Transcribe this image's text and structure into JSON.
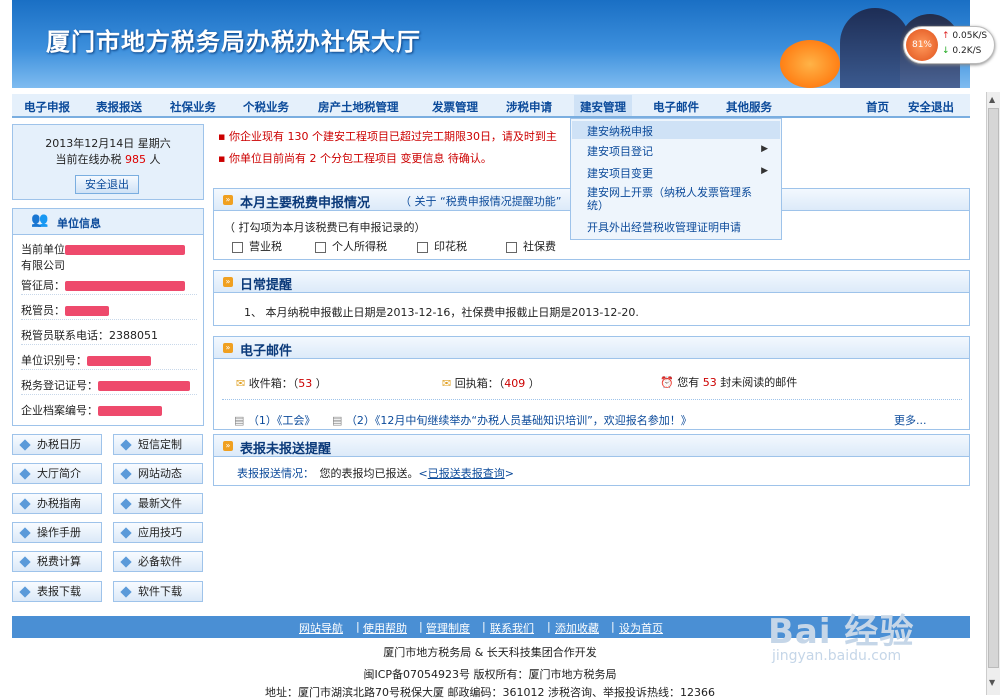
{
  "banner": {
    "title": "厦门市地方税务局办税办社保大厅"
  },
  "speed": {
    "percent": "81%",
    "up": "0.05K/S",
    "down": "0.2K/S"
  },
  "nav": {
    "items": [
      "电子申报",
      "表报报送",
      "社保业务",
      "个税业务",
      "房产土地税管理",
      "发票管理",
      "涉税申请",
      "建安管理",
      "电子邮件",
      "其他服务"
    ],
    "home": "首页",
    "logout": "安全退出"
  },
  "dropdown": [
    "建安纳税申报",
    "建安项目登记",
    "建安项目变更",
    "建安网上开票（纳税人发票管理系统）",
    "开具外出经营税收管理证明申请"
  ],
  "datebox": {
    "date": "2013年12月14日  星期六",
    "online_pre": "当前在线办税",
    "online_num": "985",
    "online_post": "人",
    "logout": "安全退出"
  },
  "unit": {
    "title": "单位信息",
    "fields": [
      "当前单位",
      "有限公司",
      "管征局：",
      "税管员：",
      "税管员联系电话：2388051",
      "单位识别号：",
      "税务登记证号：",
      "企业档案编号："
    ]
  },
  "side_buttons": [
    "办税日历",
    "短信定制",
    "大厅简介",
    "网站动态",
    "办税指南",
    "最新文件",
    "操作手册",
    "应用技巧",
    "税费计算",
    "必备软件",
    "表报下载",
    "软件下载"
  ],
  "notices": [
    "你企业现有 130 个建安工程项目已超过完工期限30日，请及时到主",
    "你单位目前尚有 2 个分包工程项目 变更信息 待确认。"
  ],
  "panel_tax": {
    "title": "本月主要税费申报情况",
    "link": "（ 关于 “税费申报情况提醒功能”",
    "hint": "（ 打勾项为本月该税费已有申报记录的）",
    "items": [
      "营业税",
      "个人所得税",
      "印花税",
      "社保费"
    ]
  },
  "panel_daily": {
    "title": "日常提醒",
    "text": "1、  本月纳税申报截止日期是2013-12-16，社保费申报截止日期是2013-12-20."
  },
  "panel_mail": {
    "title": "电子邮件",
    "inbox": "收件箱：（",
    "inbox_num": "53",
    "inbox_end": "）",
    "receipt": "回执箱：（",
    "receipt_num": "409",
    "receipt_end": "）",
    "unread_pre": "您有",
    "unread_num": "53",
    "unread_post": "封未阅读的邮件",
    "news1": "（1）《工会》",
    "news2": "（2）《12月中旬继续举办“办税人员基础知识培训”，欢迎报名参加！》",
    "more": "更多..."
  },
  "panel_report": {
    "title": "表报未报送提醒",
    "label": "表报报送情况：",
    "text": "您的表报均已报送。",
    "link": "已报送表报查询"
  },
  "footer": {
    "links": [
      "网站导航",
      "使用帮助",
      "管理制度",
      "联系我们",
      "添加收藏",
      "设为首页"
    ],
    "line1": "厦门市地方税务局 & 长天科技集团合作开发",
    "line2": "闽ICP备07054923号   版权所有：厦门市地方税务局",
    "line3": "地址：厦门市湖滨北路70号税保大厦    邮政编码：361012    涉税咨询、举报投诉热线：12366"
  },
  "watermark": {
    "w1": "Bai 经验",
    "w2": "jingyan.baidu.com"
  }
}
